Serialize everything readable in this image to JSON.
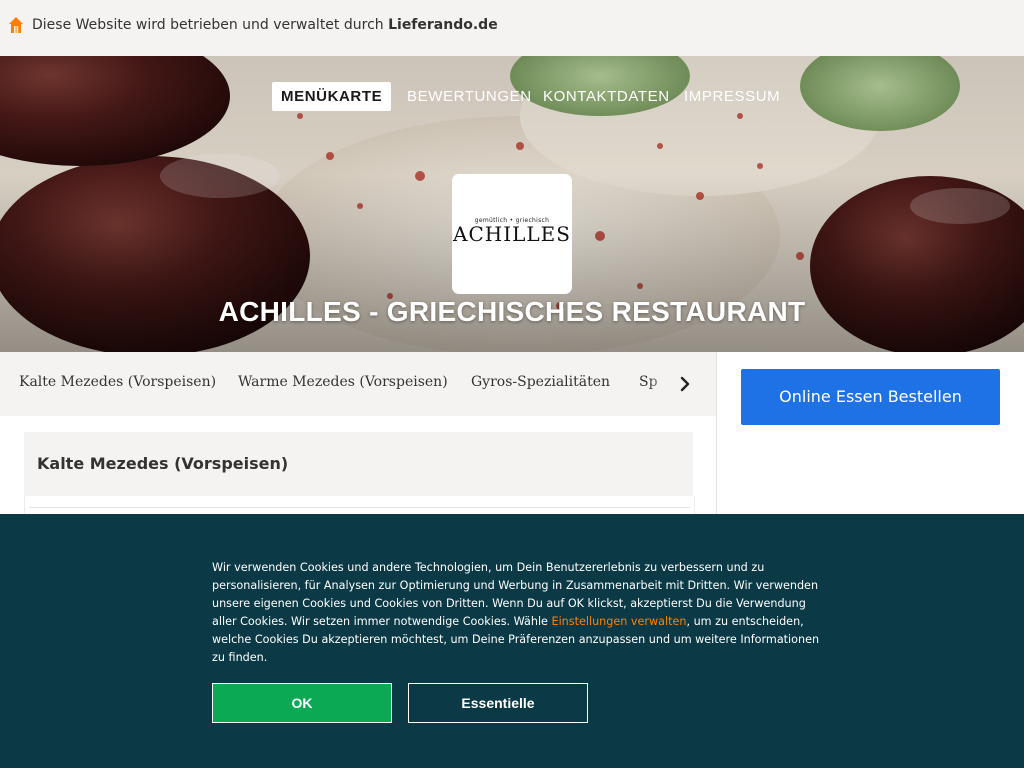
{
  "topbar": {
    "icon": "house-icon",
    "brand_color": "#ff8000",
    "text_prefix": "Diese Website wird betrieben und verwaltet durch ",
    "text_link": "Lieferando.de"
  },
  "nav": {
    "items": [
      {
        "label": "MENÜKARTE",
        "active": true
      },
      {
        "label": "BEWERTUNGEN",
        "active": false
      },
      {
        "label": "KONTAKTDATEN",
        "active": false
      },
      {
        "label": "IMPRESSUM",
        "active": false
      }
    ]
  },
  "logo": {
    "tagline": "gemütlich • griechisch",
    "name": "ACHILLES"
  },
  "restaurant": {
    "title": "ACHILLES - GRIECHISCHES RESTAURANT"
  },
  "categories": {
    "items": [
      "Kalte Mezedes (Vorspeisen)",
      "Warme Mezedes (Vorspeisen)",
      "Gyros-Spezialitäten",
      "Sp"
    ],
    "next_icon": "chevron-right-icon"
  },
  "order": {
    "label": "Online Essen Bestellen",
    "color": "#1f72e5"
  },
  "section": {
    "title": "Kalte Mezedes (Vorspeisen)"
  },
  "cookie": {
    "text_before_link": "Wir verwenden Cookies und andere Technologien, um Dein Benutzererlebnis zu verbessern und zu personalisieren, für Analysen zur Optimierung und Werbung in Zusammenarbeit mit Dritten. Wir verwenden unsere eigenen Cookies und Cookies von Dritten. Wenn Du auf OK klickst, akzeptierst Du die Verwendung aller Cookies. Wir setzen immer notwendige Cookies. Wähle ",
    "link": "Einstellungen verwalten",
    "text_after_link": ", um zu entscheiden, welche Cookies Du akzeptieren möchtest, um Deine Präferenzen anzupassen und um weitere Informationen zu finden.",
    "ok_label": "OK",
    "essential_label": "Essentielle",
    "background": "#0b3945",
    "ok_color": "#0ba953",
    "link_color": "#ff8000"
  }
}
